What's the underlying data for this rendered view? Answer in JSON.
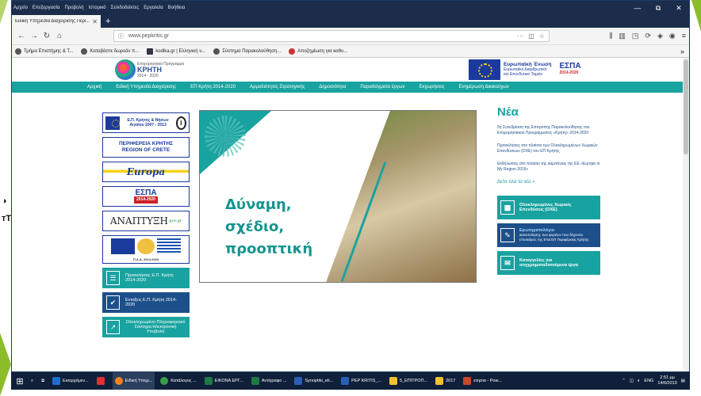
{
  "browser": {
    "menu": [
      "Αρχείο",
      "Επεξεργασία",
      "Προβολή",
      "Ιστορικό",
      "Σελιδοδείκτες",
      "Εργαλεία",
      "Βοήθεια"
    ],
    "window_controls": [
      "—",
      "⧉",
      "✕"
    ],
    "tab_title": "Ειδική Υπηρεσία Διαχείρισης Περι...",
    "url": "www.pepkritis.gr",
    "bookmarks": [
      "Τμήμα Επιστήμης & Τ...",
      "Καταβάστε δωρεάν π...",
      "kodika.gr | Ελληνική ν...",
      "Σύστημα Παρακολούθηση...",
      "Αποζημίωση για καθυ..."
    ]
  },
  "site": {
    "logo_small": "Επιχειρησιακό Πρόγραμμα",
    "logo_big": "ΚΡΗΤΗ",
    "logo_years": "2014 - 2020",
    "eu_title": "Ευρωπαϊκή Ένωση",
    "eu_sub1": "Ευρωπαϊκό Διαρθρωτικό",
    "eu_sub2": "και Επενδυτικό Ταμείο",
    "espa": "ΕΣΠΑ",
    "espa_years": "2014-2020",
    "menu": [
      "Αρχική",
      "Ειδική Υπηρεσία Διαχείρισης",
      "ΕΠ Κρήτη 2014-2020",
      "Αρμοδιότητες Στρατηγικής",
      "Δημοσιότητα",
      "Παραδείγματα έργων",
      "Εκχωρήσεις",
      "Ενημέρωση Δικαιούχων"
    ]
  },
  "sidebar": {
    "b1_text": "Ε.Π. Κρήτης & Νήσων Αιγαίου 2007 - 2013",
    "b2_line1": "ΠΕΡΙΦΕΡΕΙΑ ΚΡΗΤΗΣ",
    "b2_line2": "REGION OF CRETE",
    "b3": "Europa",
    "b4": "ΕΣΠΑ",
    "b4_years": "2014-2020",
    "b5": "ΑΝΑΠΤΥΞΗ",
    "b5_suffix": ".gov.gr",
    "b6_caption": "Π.Α.Α. 2014-2020",
    "t1": "Προσκλήσεις Ε.Π. Κρήτη 2014-2020",
    "t2": "Ενταξεις Ε.Π. Κρήτη 2014-2020",
    "t3": "Ολοκληρωμένο Πληροφοριακό Σύστημα Ηλεκτρονική Υποβολή"
  },
  "hero": {
    "line1": "Δύναμη,",
    "line2": "σχέδιο,",
    "line3": "προοπτική"
  },
  "news": {
    "title": "Νέα",
    "items": [
      "5η Συνεδρίαση της Επιτροπής Παρακολούθησης του Επιχειρησιακού Προγράμματος «Κρήτη» 2014-2020",
      "Προσκλήσεις στο πλαίσιο των Ολοκληρωμένων Χωρικών Επενδύσεων (ΟΧΕ) του ΕΠ Κρήτης",
      "Εκδηλώσεις στο πλαίσιο της καμπάνιας της ΕΕ «Europe in My Region 2019»"
    ],
    "all": "Δείτε όλα τα νέα »",
    "btn1": "Ολοκληρωμένες Χωρικές Επενδύσεις (ΟΧΕ)",
    "btn2_title": "Ερωτηματολόγιο",
    "btn2_text": "ικανοποίησης των φορέων που δέχονται επισκέψεις της ΕΥΔ ΕΠ Περιφέρειας Κρήτης",
    "btn3": "Καταγγελίες για συγχρηματοδοτούμενα έργα"
  },
  "taskbar": {
    "items": [
      "Εισερχόμεν...",
      "",
      "Ειδική Υπηρ...",
      "Κατάλογος ...",
      "ΕΙΚΟΝΑ ΕΡΓ...",
      "Αντίγραφο ...",
      "Synoptiki_eti...",
      "PEP KRITIS_...",
      "5_ΕΠΙΤΡΟΠ...",
      "2017",
      "ετησια - Pow..."
    ],
    "lang": "ENG",
    "time": "2:51 μμ",
    "date": "14/6/2019"
  },
  "colors": {
    "teal": "#19a3a0",
    "navy": "#1d4f8a",
    "eu_blue": "#1a3a9c"
  }
}
